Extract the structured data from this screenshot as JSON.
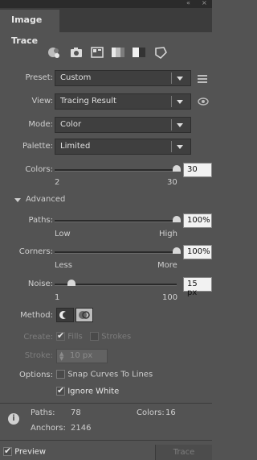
{
  "panel": {
    "tab_label": "Image Trace",
    "collapse_glyph": "«",
    "close_glyph": "×"
  },
  "preset_icons": [
    "auto-color-icon",
    "high-color-icon",
    "low-color-icon",
    "grayscale-icon",
    "black-and-white-icon",
    "outline-icon"
  ],
  "preset": {
    "label": "Preset:",
    "value": "Custom"
  },
  "view": {
    "label": "View:",
    "value": "Tracing Result"
  },
  "mode": {
    "label": "Mode:",
    "value": "Color"
  },
  "palette": {
    "label": "Palette:",
    "value": "Limited"
  },
  "colors": {
    "label": "Colors:",
    "value": "30",
    "min_label": "2",
    "max_label": "30",
    "level": 1.0
  },
  "advanced": {
    "label": "Advanced"
  },
  "paths": {
    "label": "Paths:",
    "value": "100%",
    "min_label": "Low",
    "max_label": "High",
    "level": 1.0
  },
  "corners": {
    "label": "Corners:",
    "value": "100%",
    "min_label": "Less",
    "max_label": "More",
    "level": 1.0
  },
  "noise": {
    "label": "Noise:",
    "value": "15 px",
    "min_label": "1",
    "max_label": "100",
    "level": 0.14
  },
  "method": {
    "label": "Method:"
  },
  "create": {
    "label": "Create:",
    "fills": "Fills",
    "strokes": "Strokes"
  },
  "stroke": {
    "label": "Stroke:",
    "value": "10 px"
  },
  "options": {
    "label": "Options:",
    "snap": "Snap Curves To Lines",
    "ignore_white": "Ignore White"
  },
  "stats": {
    "paths_label": "Paths:",
    "paths_value": "78",
    "colors_label": "Colors:",
    "colors_value": "16",
    "anchors_label": "Anchors:",
    "anchors_value": "2146"
  },
  "footer": {
    "preview": "Preview",
    "trace": "Trace"
  },
  "colors_theme": {
    "panel_bg": "#535353",
    "field_bg": "#3f3f3f",
    "value_bg": "#f2f2f2"
  }
}
